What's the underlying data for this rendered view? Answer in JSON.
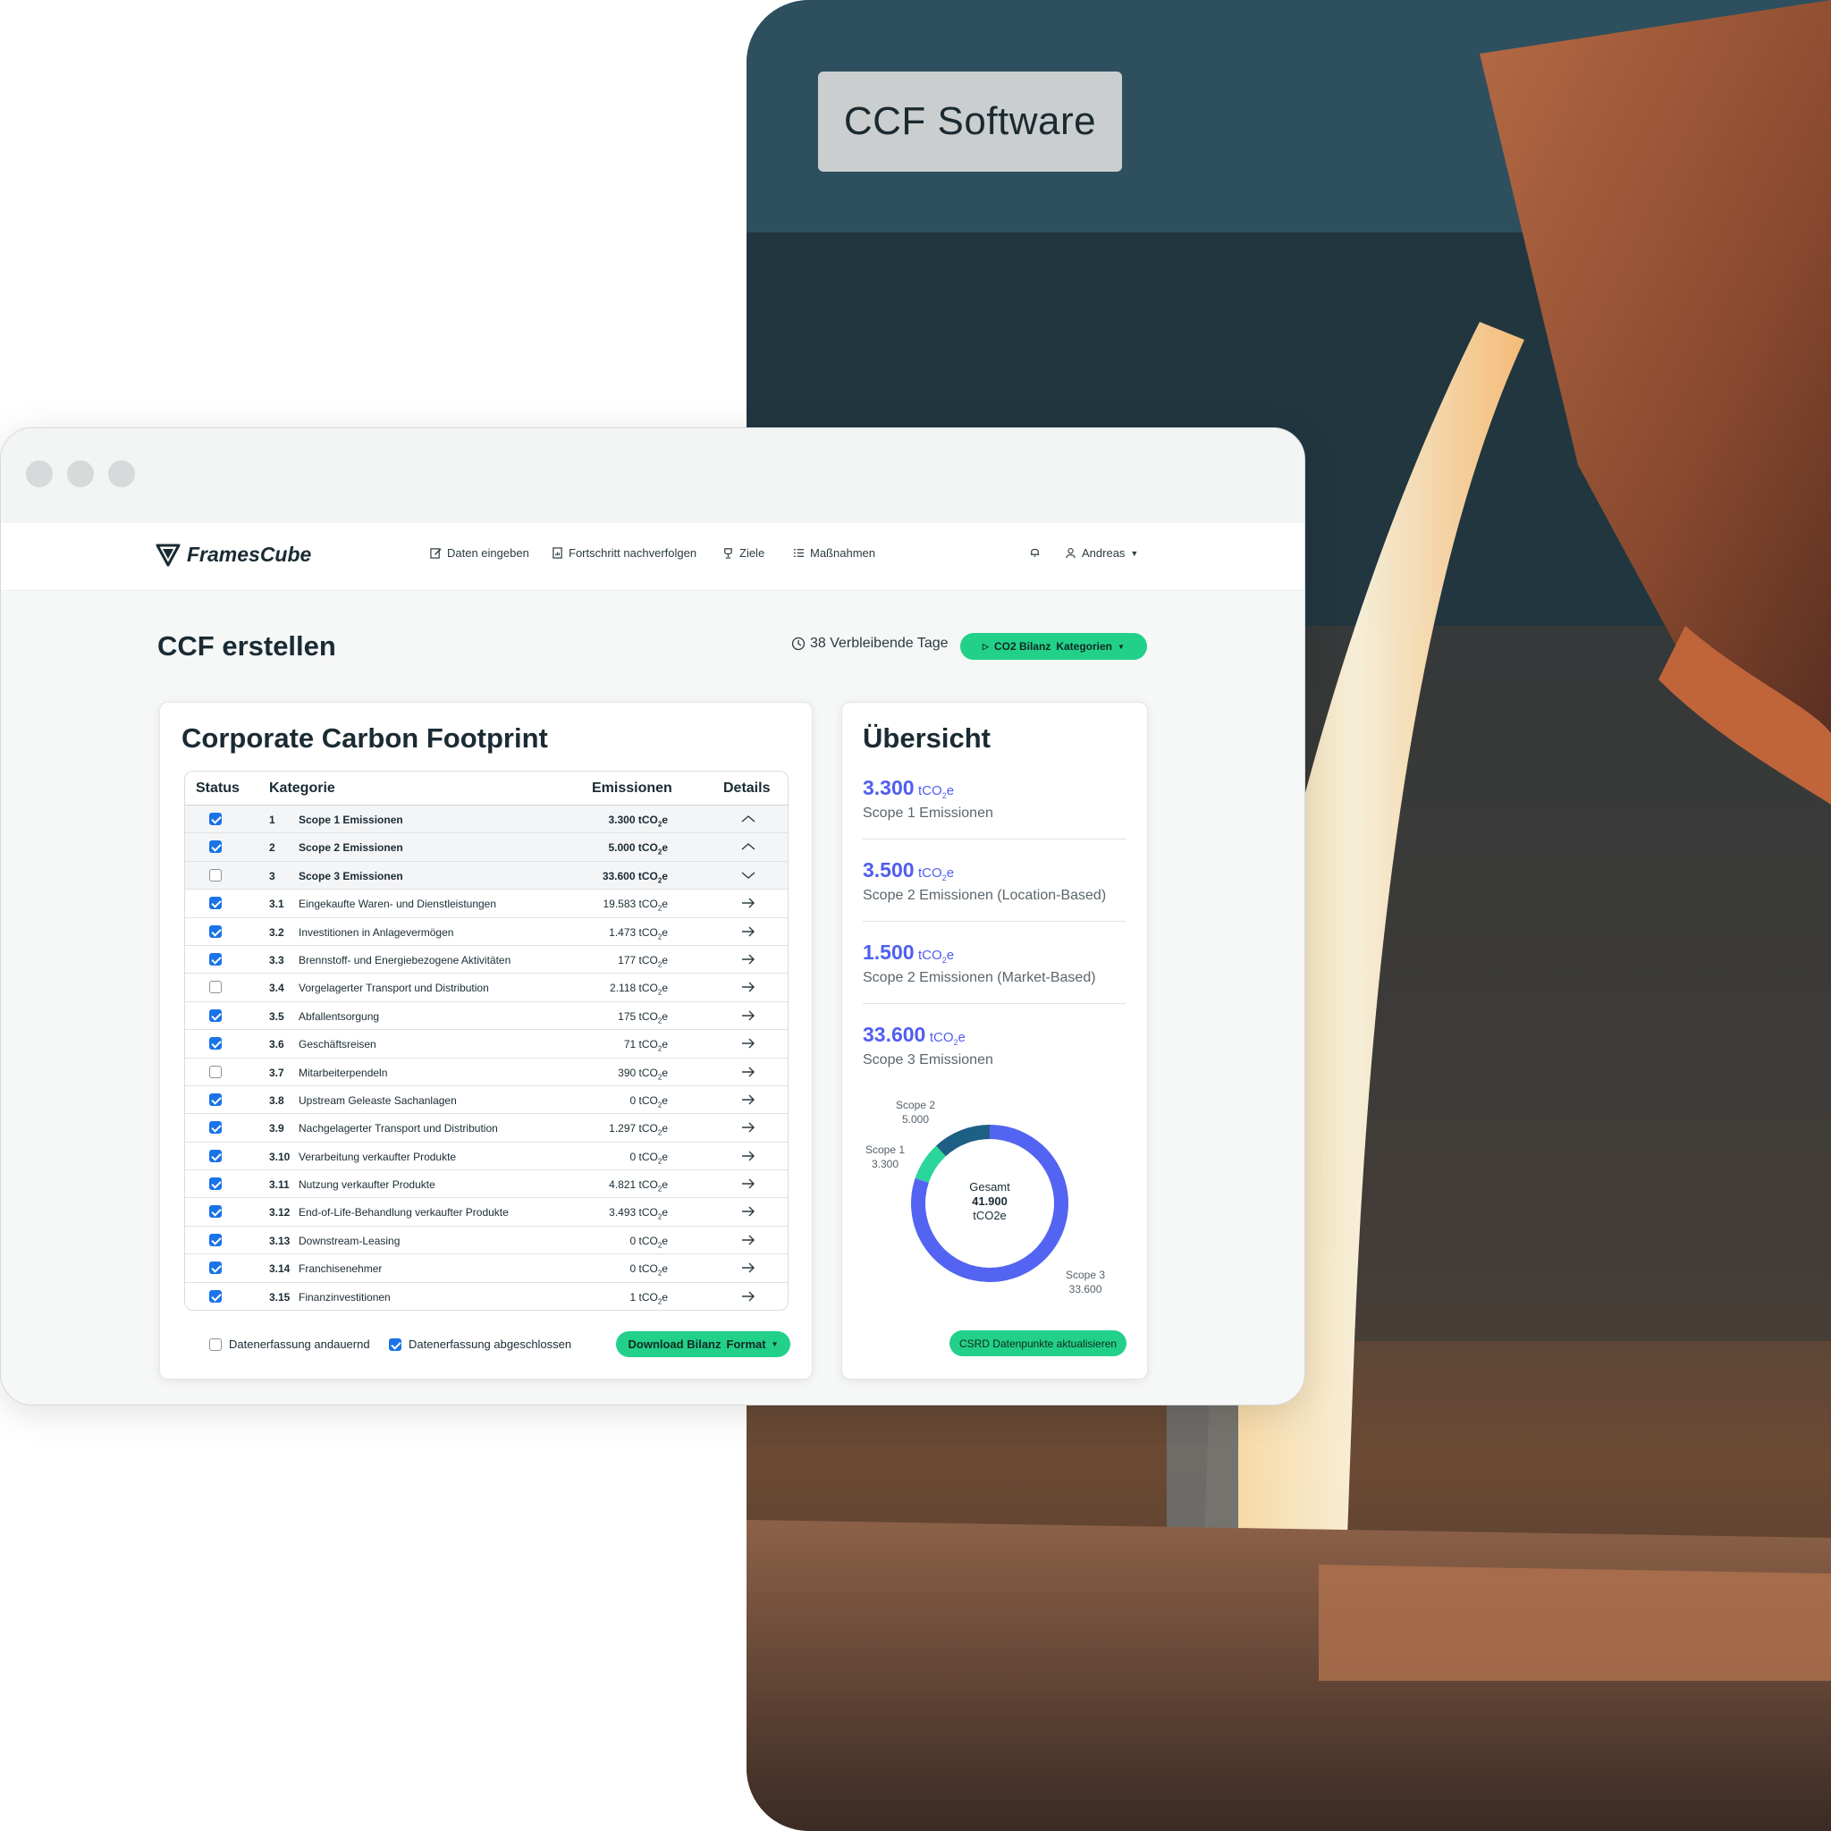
{
  "hero": {
    "label": "CCF Software"
  },
  "app": {
    "logo_text": "FramesCube",
    "nav": [
      {
        "label": "Daten eingeben",
        "icon": "edit-icon"
      },
      {
        "label": "Fortschritt nachverfolgen",
        "icon": "report-icon"
      },
      {
        "label": "Ziele",
        "icon": "trophy-icon"
      },
      {
        "label": "Maßnahmen",
        "icon": "list-icon"
      }
    ],
    "user": "Andreas",
    "page_title": "CCF erstellen",
    "days_remaining": "38 Verbleibende Tage",
    "bilanz_button": {
      "label": "CO2 Bilanz",
      "dropdown": "Kategorien"
    }
  },
  "ccf": {
    "title": "Corporate Carbon Footprint",
    "headers": {
      "status": "Status",
      "kategorie": "Kategorie",
      "emissionen": "Emissionen",
      "details": "Details"
    },
    "unit": "tCO₂e",
    "rows": [
      {
        "checked": true,
        "num": "1",
        "label": "Scope 1 Emissionen",
        "value": "3.300",
        "main": true,
        "detail": "chevron-up"
      },
      {
        "checked": true,
        "num": "2",
        "label": "Scope 2 Emissionen",
        "value": "5.000",
        "main": true,
        "detail": "chevron-up"
      },
      {
        "checked": false,
        "num": "3",
        "label": "Scope 3 Emissionen",
        "value": "33.600",
        "main": true,
        "detail": "chevron-down"
      },
      {
        "checked": true,
        "num": "3.1",
        "label": "Eingekaufte Waren- und Dienstleistungen",
        "value": "19.583",
        "detail": "arrow"
      },
      {
        "checked": true,
        "num": "3.2",
        "label": "Investitionen in Anlagevermögen",
        "value": "1.473",
        "detail": "arrow"
      },
      {
        "checked": true,
        "num": "3.3",
        "label": "Brennstoff- und Energiebezogene Aktivitäten",
        "value": "177",
        "detail": "arrow"
      },
      {
        "checked": false,
        "num": "3.4",
        "label": "Vorgelagerter Transport und Distribution",
        "value": "2.118",
        "detail": "arrow"
      },
      {
        "checked": true,
        "num": "3.5",
        "label": "Abfallentsorgung",
        "value": "175",
        "detail": "arrow"
      },
      {
        "checked": true,
        "num": "3.6",
        "label": "Geschäftsreisen",
        "value": "71",
        "detail": "arrow"
      },
      {
        "checked": false,
        "num": "3.7",
        "label": "Mitarbeiterpendeln",
        "value": "390",
        "detail": "arrow"
      },
      {
        "checked": true,
        "num": "3.8",
        "label": "Upstream Geleaste Sachanlagen",
        "value": "0",
        "detail": "arrow"
      },
      {
        "checked": true,
        "num": "3.9",
        "label": "Nachgelagerter Transport und Distribution",
        "value": "1.297",
        "detail": "arrow"
      },
      {
        "checked": true,
        "num": "3.10",
        "label": "Verarbeitung verkaufter Produkte",
        "value": "0",
        "detail": "arrow"
      },
      {
        "checked": true,
        "num": "3.11",
        "label": "Nutzung verkaufter Produkte",
        "value": "4.821",
        "detail": "arrow"
      },
      {
        "checked": true,
        "num": "3.12",
        "label": "End-of-Life-Behandlung verkaufter Produkte",
        "value": "3.493",
        "detail": "arrow"
      },
      {
        "checked": true,
        "num": "3.13",
        "label": "Downstream-Leasing",
        "value": "0",
        "detail": "arrow"
      },
      {
        "checked": true,
        "num": "3.14",
        "label": "Franchisenehmer",
        "value": "0",
        "detail": "arrow"
      },
      {
        "checked": true,
        "num": "3.15",
        "label": "Finanzinvestitionen",
        "value": "1",
        "detail": "arrow"
      }
    ],
    "footer": {
      "ongoing": {
        "label": "Datenerfassung andauernd",
        "checked": false
      },
      "done": {
        "label": "Datenerfassung abgeschlossen",
        "checked": true
      },
      "download": {
        "label": "Download Bilanz",
        "dropdown": "Format"
      }
    }
  },
  "overview": {
    "title": "Übersicht",
    "unit": "tCO₂e",
    "items": [
      {
        "value": "3.300",
        "label": "Scope 1 Emissionen"
      },
      {
        "value": "3.500",
        "label": "Scope 2 Emissionen (Location-Based)"
      },
      {
        "value": "1.500",
        "label": "Scope 2 Emissionen (Market-Based)"
      },
      {
        "value": "33.600",
        "label": "Scope 3 Emissionen"
      }
    ],
    "csrd_button": "CSRD Datenpunkte aktualisieren"
  },
  "chart_data": {
    "type": "pie",
    "categories": [
      "Scope 1",
      "Scope 2",
      "Scope 3"
    ],
    "values": [
      3300,
      5000,
      33600
    ],
    "value_labels": [
      "3.300",
      "5.000",
      "33.600"
    ],
    "colors": [
      "#2ad69a",
      "#1e5f86",
      "#5364f2"
    ],
    "center": {
      "line1": "Gesamt",
      "line2": "41.900",
      "line3": "tCO2e"
    }
  },
  "colors": {
    "accent_green": "#22d08a",
    "accent_blue": "#4f5ef0",
    "checkbox_blue": "#1a73e8"
  }
}
